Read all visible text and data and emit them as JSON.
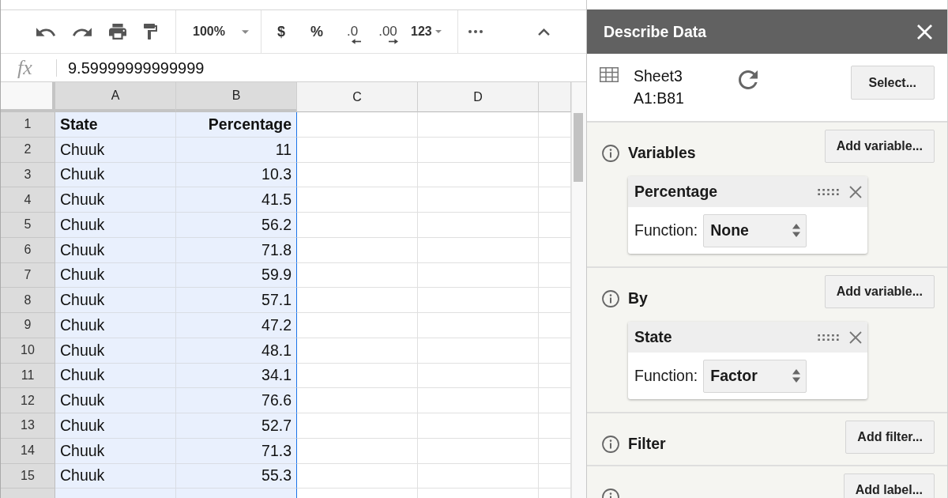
{
  "toolbar": {
    "zoom": {
      "label": "100%"
    },
    "format_buttons": [
      {
        "label": "$",
        "kind": "plain"
      },
      {
        "label": "%",
        "kind": "plain"
      },
      {
        "label": ".0",
        "kind": "decrease-decimals"
      },
      {
        "label": ".00",
        "kind": "increase-decimals"
      },
      {
        "label": "123",
        "kind": "dropdown"
      }
    ]
  },
  "formula_bar": {
    "label": "fx",
    "value": "9.59999999999999"
  },
  "sheet": {
    "columns": [
      {
        "label": "A",
        "selected": true
      },
      {
        "label": "B",
        "selected": true
      },
      {
        "label": "C",
        "selected": false
      },
      {
        "label": "D",
        "selected": false
      }
    ],
    "rows": [
      {
        "number": "1",
        "selected": true,
        "kind": "header",
        "cells": [
          "State",
          "Percentage"
        ]
      },
      {
        "number": "2",
        "selected": true,
        "kind": "data",
        "cells": [
          "Chuuk",
          "11"
        ]
      },
      {
        "number": "3",
        "selected": true,
        "kind": "data",
        "cells": [
          "Chuuk",
          "10.3"
        ]
      },
      {
        "number": "4",
        "selected": true,
        "kind": "data",
        "cells": [
          "Chuuk",
          "41.5"
        ]
      },
      {
        "number": "5",
        "selected": true,
        "kind": "data",
        "cells": [
          "Chuuk",
          "56.2"
        ]
      },
      {
        "number": "6",
        "selected": true,
        "kind": "data",
        "cells": [
          "Chuuk",
          "71.8"
        ]
      },
      {
        "number": "7",
        "selected": true,
        "kind": "data",
        "cells": [
          "Chuuk",
          "59.9"
        ]
      },
      {
        "number": "8",
        "selected": true,
        "kind": "data",
        "cells": [
          "Chuuk",
          "57.1"
        ]
      },
      {
        "number": "9",
        "selected": true,
        "kind": "data",
        "cells": [
          "Chuuk",
          "47.2"
        ]
      },
      {
        "number": "10",
        "selected": true,
        "kind": "data",
        "cells": [
          "Chuuk",
          "48.1"
        ]
      },
      {
        "number": "11",
        "selected": true,
        "kind": "data",
        "cells": [
          "Chuuk",
          "34.1"
        ]
      },
      {
        "number": "12",
        "selected": true,
        "kind": "data",
        "cells": [
          "Chuuk",
          "76.6"
        ]
      },
      {
        "number": "13",
        "selected": true,
        "kind": "data",
        "cells": [
          "Chuuk",
          "52.7"
        ]
      },
      {
        "number": "14",
        "selected": true,
        "kind": "data",
        "cells": [
          "Chuuk",
          "71.3"
        ]
      },
      {
        "number": "15",
        "selected": true,
        "kind": "data",
        "cells": [
          "Chuuk",
          "55.3"
        ]
      }
    ]
  },
  "panel": {
    "title": "Describe Data",
    "range": {
      "sheet": "Sheet3",
      "cells": "A1:B81",
      "button": "Select..."
    },
    "sections": [
      {
        "title": "Variables",
        "button": "Add variable...",
        "cards": [
          {
            "name": "Percentage",
            "function_label": "Function:",
            "function": "None"
          }
        ]
      },
      {
        "title": "By",
        "button": "Add variable...",
        "cards": [
          {
            "name": "State",
            "function_label": "Function:",
            "function": "Factor"
          }
        ]
      },
      {
        "title": "Filter",
        "button": "Add filter..."
      },
      {
        "button": "Add label..."
      }
    ]
  }
}
